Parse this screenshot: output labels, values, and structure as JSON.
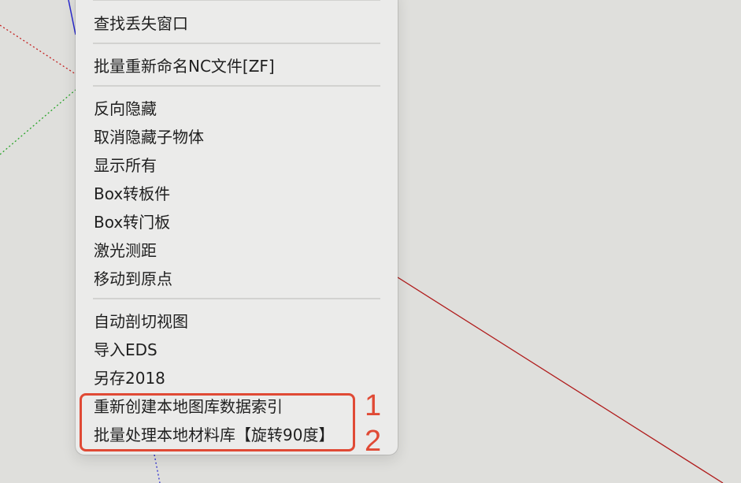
{
  "menu": {
    "groups": [
      {
        "items": [
          "查找丢失窗口"
        ]
      },
      {
        "items": [
          "批量重新命名NC文件[ZF]"
        ]
      },
      {
        "items": [
          "反向隐藏",
          "取消隐藏子物体",
          "显示所有",
          "Box转板件",
          "Box转门板",
          "激光测距",
          "移动到原点"
        ]
      },
      {
        "items": [
          "自动剖切视图",
          "导入EDS",
          "另存2018",
          "重新创建本地图库数据索引",
          "批量处理本地材料库【旋转90度】"
        ]
      }
    ]
  },
  "annotations": {
    "labels": [
      "1",
      "2"
    ],
    "color": "#e04a35"
  },
  "viewport": {
    "background": "#dfdfdc",
    "axis_colors": {
      "red": "#b01c1c",
      "green": "#28a428",
      "blue": "#2a2ad0"
    }
  }
}
